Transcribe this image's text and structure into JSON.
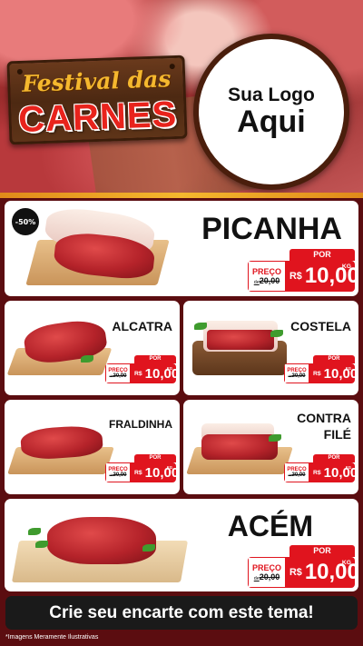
{
  "hero": {
    "festival_text": "Festival das",
    "carnes_text": "CARNES",
    "logo_line1": "Sua Logo",
    "logo_line2": "Aqui"
  },
  "products": [
    {
      "name": "PICANHA",
      "discount": "-50%",
      "por": "POR",
      "preco_label": "PREÇO",
      "de": "de",
      "old_price": "20,00",
      "currency": "R$",
      "new_price": "10,00",
      "unit": "KG"
    },
    {
      "name": "ALCATRA",
      "por": "POR",
      "preco_label": "PREÇO",
      "de": "de",
      "old_price": "20,00",
      "currency": "R$",
      "new_price": "10,00",
      "unit": "KG"
    },
    {
      "name": "COSTELA",
      "por": "POR",
      "preco_label": "PREÇO",
      "de": "de",
      "old_price": "20,00",
      "currency": "R$",
      "new_price": "10,00",
      "unit": "KG"
    },
    {
      "name": "FRALDINHA",
      "por": "POR",
      "preco_label": "PREÇO",
      "de": "de",
      "old_price": "20,00",
      "currency": "R$",
      "new_price": "10,00",
      "unit": "KG"
    },
    {
      "name_line1": "CONTRA",
      "name_line2": "FILÉ",
      "por": "POR",
      "preco_label": "PREÇO",
      "de": "de",
      "old_price": "20,00",
      "currency": "R$",
      "new_price": "10,00",
      "unit": "KG"
    },
    {
      "name": "ACÉM",
      "por": "POR",
      "preco_label": "PREÇO",
      "de": "de",
      "old_price": "20,00",
      "currency": "R$",
      "new_price": "10,00",
      "unit": "KG"
    }
  ],
  "cta": "Crie seu encarte com este tema!",
  "disclaimer": "*Imagens Meramente Ilustrativas",
  "colors": {
    "accent": "#e0141e",
    "background": "#5b0d10",
    "gold": "#f5b82e"
  }
}
